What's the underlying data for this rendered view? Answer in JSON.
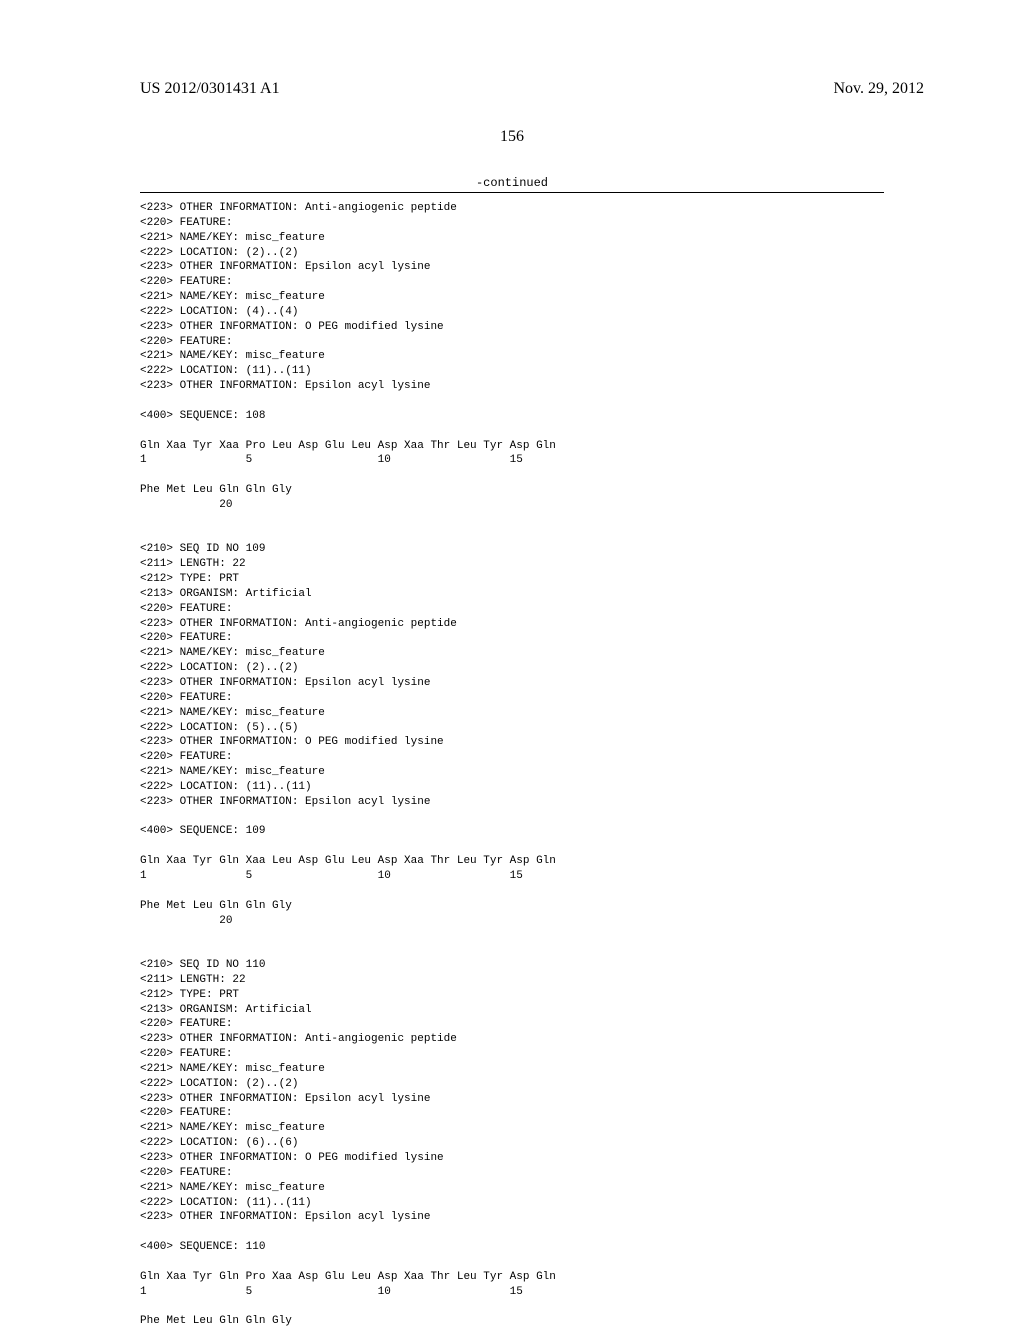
{
  "header": {
    "pub_number": "US 2012/0301431 A1",
    "pub_date": "Nov. 29, 2012"
  },
  "page_number": "156",
  "continued_label": "-continued",
  "sequence_text": "<223> OTHER INFORMATION: Anti-angiogenic peptide\n<220> FEATURE:\n<221> NAME/KEY: misc_feature\n<222> LOCATION: (2)..(2)\n<223> OTHER INFORMATION: Epsilon acyl lysine\n<220> FEATURE:\n<221> NAME/KEY: misc_feature\n<222> LOCATION: (4)..(4)\n<223> OTHER INFORMATION: O PEG modified lysine\n<220> FEATURE:\n<221> NAME/KEY: misc_feature\n<222> LOCATION: (11)..(11)\n<223> OTHER INFORMATION: Epsilon acyl lysine\n\n<400> SEQUENCE: 108\n\nGln Xaa Tyr Xaa Pro Leu Asp Glu Leu Asp Xaa Thr Leu Tyr Asp Gln\n1               5                   10                  15\n\nPhe Met Leu Gln Gln Gly\n            20\n\n\n<210> SEQ ID NO 109\n<211> LENGTH: 22\n<212> TYPE: PRT\n<213> ORGANISM: Artificial\n<220> FEATURE:\n<223> OTHER INFORMATION: Anti-angiogenic peptide\n<220> FEATURE:\n<221> NAME/KEY: misc_feature\n<222> LOCATION: (2)..(2)\n<223> OTHER INFORMATION: Epsilon acyl lysine\n<220> FEATURE:\n<221> NAME/KEY: misc_feature\n<222> LOCATION: (5)..(5)\n<223> OTHER INFORMATION: O PEG modified lysine\n<220> FEATURE:\n<221> NAME/KEY: misc_feature\n<222> LOCATION: (11)..(11)\n<223> OTHER INFORMATION: Epsilon acyl lysine\n\n<400> SEQUENCE: 109\n\nGln Xaa Tyr Gln Xaa Leu Asp Glu Leu Asp Xaa Thr Leu Tyr Asp Gln\n1               5                   10                  15\n\nPhe Met Leu Gln Gln Gly\n            20\n\n\n<210> SEQ ID NO 110\n<211> LENGTH: 22\n<212> TYPE: PRT\n<213> ORGANISM: Artificial\n<220> FEATURE:\n<223> OTHER INFORMATION: Anti-angiogenic peptide\n<220> FEATURE:\n<221> NAME/KEY: misc_feature\n<222> LOCATION: (2)..(2)\n<223> OTHER INFORMATION: Epsilon acyl lysine\n<220> FEATURE:\n<221> NAME/KEY: misc_feature\n<222> LOCATION: (6)..(6)\n<223> OTHER INFORMATION: O PEG modified lysine\n<220> FEATURE:\n<221> NAME/KEY: misc_feature\n<222> LOCATION: (11)..(11)\n<223> OTHER INFORMATION: Epsilon acyl lysine\n\n<400> SEQUENCE: 110\n\nGln Xaa Tyr Gln Pro Xaa Asp Glu Leu Asp Xaa Thr Leu Tyr Asp Gln\n1               5                   10                  15\n\nPhe Met Leu Gln Gln Gly"
}
